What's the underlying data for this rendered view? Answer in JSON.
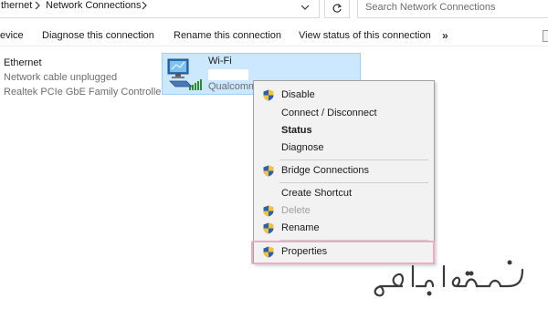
{
  "address_bar": {
    "crumbs": [
      "thernet",
      "Network Connections"
    ],
    "search_placeholder": "Search Network Connections"
  },
  "toolbar": {
    "items": [
      "evice",
      "Diagnose this connection",
      "Rename this connection",
      "View status of this connection"
    ],
    "more_label": "»"
  },
  "adapters": {
    "ethernet": {
      "name": "Ethernet",
      "status": "Network cable unplugged",
      "device": "Realtek PCIe GbE Family Controller"
    },
    "wifi": {
      "name": "Wi-Fi",
      "device": "Qualcomm"
    }
  },
  "context_menu": {
    "items": [
      {
        "label": "Disable",
        "shield": true
      },
      {
        "label": "Connect / Disconnect",
        "shield": false
      },
      {
        "label": "Status",
        "shield": false,
        "bold": true
      },
      {
        "label": "Diagnose",
        "shield": false
      },
      {
        "label": "Bridge Connections",
        "shield": true
      },
      {
        "label": "Create Shortcut",
        "shield": false
      },
      {
        "label": "Delete",
        "shield": true,
        "disabled": true
      },
      {
        "label": "Rename",
        "shield": true
      },
      {
        "label": "Properties",
        "shield": true
      }
    ]
  },
  "colors": {
    "selection_fill": "#cce8ff",
    "selection_border": "#99d1ff",
    "menu_bg": "#f2f2f2",
    "highlight": "#f3a8c6",
    "watermark": "#3a3a3a"
  },
  "icons": [
    "chevron-right-icon",
    "chevron-down-icon",
    "refresh-icon",
    "network-adapter-icon",
    "signal-bars-icon",
    "uac-shield-icon"
  ],
  "watermark": {
    "text": "خدمت ازما"
  }
}
